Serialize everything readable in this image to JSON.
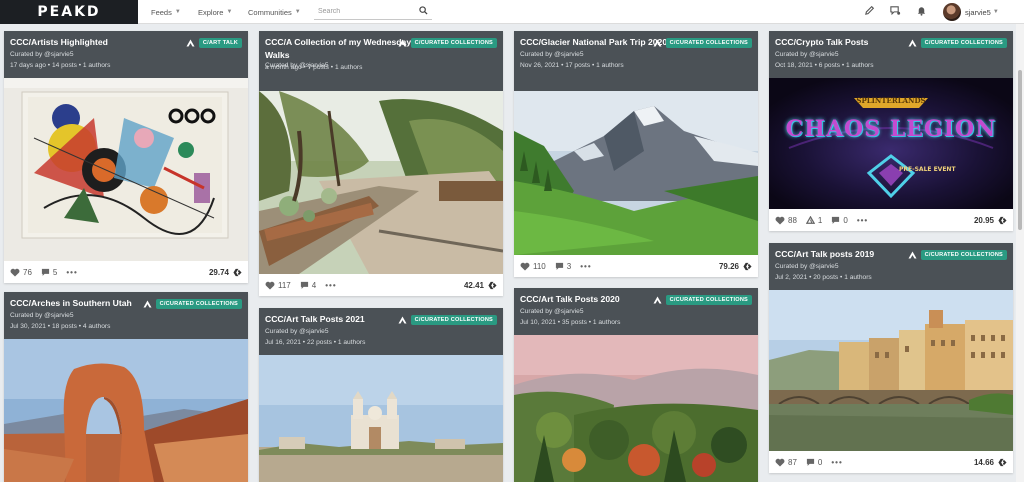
{
  "app": {
    "logo": "PEAKD"
  },
  "nav": {
    "feeds": "Feeds",
    "explore": "Explore",
    "communities": "Communities",
    "search_placeholder": "Search",
    "username": "sjarvie5"
  },
  "colors": {
    "header_bg": "#4b5156",
    "badge_bg": "#2a9a82",
    "logo_bg": "#1c1f23"
  },
  "cards": [
    {
      "title": "CCC/Artists Highlighted",
      "curated_by": "Curated by @sjarvie5",
      "age": "17 days ago",
      "posts": "14 posts",
      "authors": "1 authors",
      "badge": "C/ART TALK",
      "likes": "76",
      "comments": "5",
      "payout": "29.74"
    },
    {
      "title": "CCC/A Collection of my Wednesday Walks",
      "curated_by": "Curated by @sjarvie5",
      "age": "a month ago",
      "posts": "7 posts",
      "authors": "1 authors",
      "badge": "C/CURATED COLLECTIONS",
      "likes": "117",
      "comments": "4",
      "payout": "42.41"
    },
    {
      "title": "CCC/Glacier National Park Trip 2020",
      "curated_by": "Curated by @sjarvie5",
      "age": "Nov 26, 2021",
      "posts": "17 posts",
      "authors": "1 authors",
      "badge": "C/CURATED COLLECTIONS",
      "likes": "110",
      "comments": "3",
      "payout": "79.26"
    },
    {
      "title": "CCC/Crypto Talk Posts",
      "curated_by": "Curated by @sjarvie5",
      "age": "Oct 18, 2021",
      "posts": "6 posts",
      "authors": "1 authors",
      "badge": "C/CURATED COLLECTIONS",
      "image_text_1": "SPLINTERLANDS",
      "image_text_2": "CHAOS LEGION",
      "image_text_3": "PRE-SALE EVENT",
      "likes": "88",
      "comments": "0",
      "reblogs": "1",
      "payout": "20.95"
    },
    {
      "title": "CCC/Arches in Southern Utah",
      "curated_by": "Curated by @sjarvie5",
      "age": "Jul 30, 2021",
      "posts": "18 posts",
      "authors": "4 authors",
      "badge": "C/CURATED COLLECTIONS"
    },
    {
      "title": "CCC/Art Talk Posts 2021",
      "curated_by": "Curated by @sjarvie5",
      "age": "Jul 16, 2021",
      "posts": "22 posts",
      "authors": "1 authors",
      "badge": "C/CURATED COLLECTIONS"
    },
    {
      "title": "CCC/Art Talk Posts 2020",
      "curated_by": "Curated by @sjarvie5",
      "age": "Jul 10, 2021",
      "posts": "35 posts",
      "authors": "1 authors",
      "badge": "C/CURATED COLLECTIONS"
    },
    {
      "title": "CCC/Art Talk posts 2019",
      "curated_by": "Curated by @sjarvie5",
      "age": "Jul 2, 2021",
      "posts": "20 posts",
      "authors": "1 authors",
      "badge": "C/CURATED COLLECTIONS",
      "likes": "87",
      "comments": "0",
      "payout": "14.66"
    }
  ],
  "separator": "•",
  "icons": {
    "heart": "heart-icon",
    "comment": "comment-icon",
    "reblog": "reblog-icon",
    "more": "more-icon",
    "hive": "hive-icon",
    "community": "community-triangle-icon",
    "pencil": "pencil-icon",
    "chat": "chat-icon",
    "bell": "bell-icon",
    "search": "search-icon"
  }
}
